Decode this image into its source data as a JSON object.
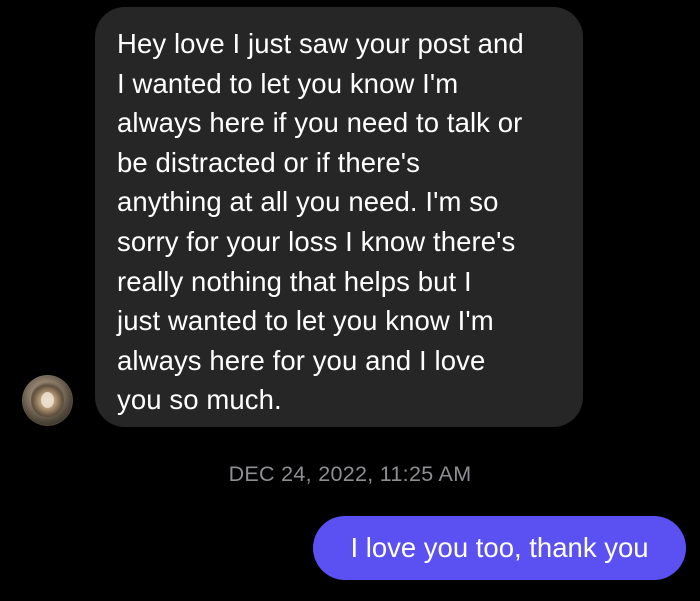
{
  "conversation": {
    "incoming_message": {
      "text": "Hey love I just saw your post and\nI wanted to let you know I'm\nalways here if you need to talk or\nbe distracted or if there's\nanything at all you need. I'm so\nsorry for your loss I know there's\nreally nothing that helps  but I\njust wanted to let you know I'm\nalways here for you and I love\nyou so much."
    },
    "timestamp": "DEC 24, 2022, 11:25 AM",
    "outgoing_message": {
      "text": "I love you too, thank you"
    }
  },
  "colors": {
    "background": "#000000",
    "incoming_bubble": "#262626",
    "outgoing_bubble": "#5b51f2",
    "timestamp_text": "#8e8e93",
    "message_text": "#ffffff"
  },
  "icons": {
    "avatar": "sender-profile-photo"
  }
}
